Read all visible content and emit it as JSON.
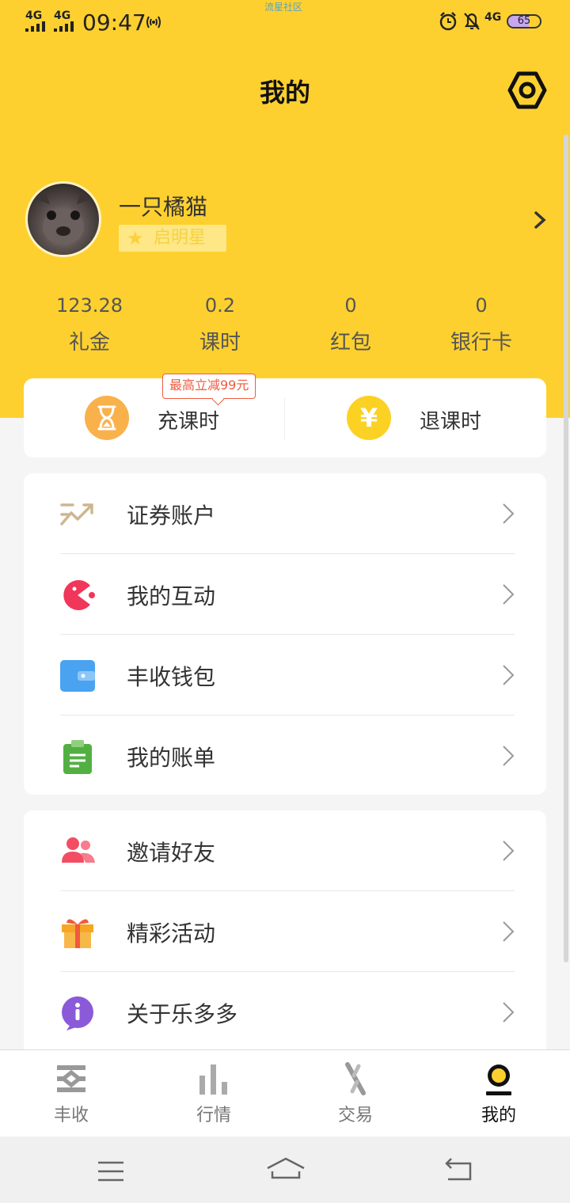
{
  "status_bar": {
    "network_1": "4G",
    "network_2": "4G",
    "time": "09:47",
    "network_3": "4G",
    "battery": "65",
    "watermark": "流星社区"
  },
  "header": {
    "title": "我的"
  },
  "profile": {
    "nickname": "一只橘猫",
    "badge": "启明星"
  },
  "stats": [
    {
      "value": "123.28",
      "label": "礼金"
    },
    {
      "value": "0.2",
      "label": "课时"
    },
    {
      "value": "0",
      "label": "红包"
    },
    {
      "value": "0",
      "label": "银行卡"
    }
  ],
  "actions": {
    "promo": "最高立减99元",
    "recharge": "充课时",
    "refund": "退课时",
    "refund_icon_glyph": "¥"
  },
  "menu_group_1": [
    {
      "label": "证券账户",
      "icon": "trend-icon"
    },
    {
      "label": "我的互动",
      "icon": "pacman-icon"
    },
    {
      "label": "丰收钱包",
      "icon": "wallet-icon"
    },
    {
      "label": "我的账单",
      "icon": "bill-icon"
    }
  ],
  "menu_group_2": [
    {
      "label": "邀请好友",
      "icon": "friends-icon"
    },
    {
      "label": "精彩活动",
      "icon": "gift-icon"
    },
    {
      "label": "关于乐多多",
      "icon": "info-icon"
    }
  ],
  "tabs": [
    {
      "label": "丰收",
      "icon": "harvest-icon"
    },
    {
      "label": "行情",
      "icon": "chart-icon"
    },
    {
      "label": "交易",
      "icon": "trade-icon"
    },
    {
      "label": "我的",
      "icon": "profile-icon",
      "active": true
    }
  ],
  "colors": {
    "brand_yellow": "#fdd02f",
    "promo_red": "#f05a3e",
    "recharge_orange": "#f9b14b",
    "refund_yellow": "#fbd124"
  }
}
